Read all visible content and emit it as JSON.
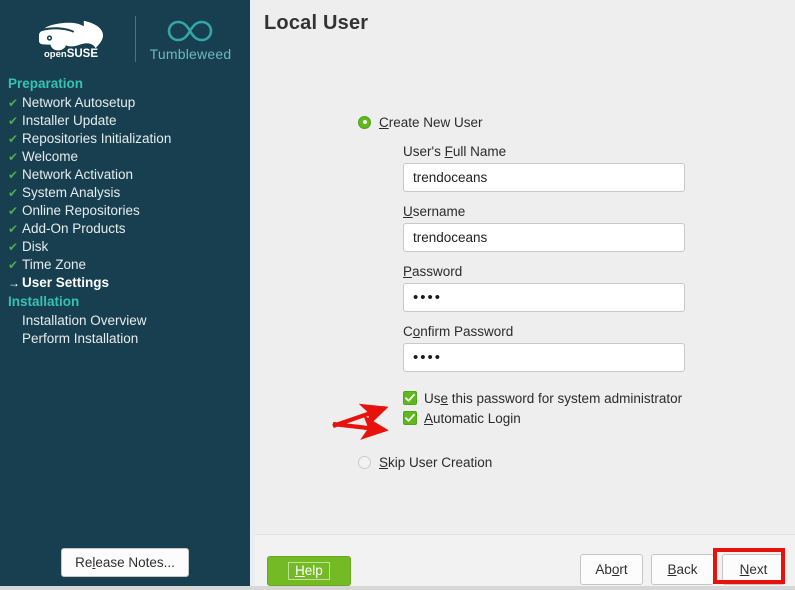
{
  "branding": {
    "product_name": "openSUSE",
    "product_suffix": "SUSE",
    "product_prefix": "open",
    "edition": "Tumbleweed"
  },
  "sidebar": {
    "sections": [
      {
        "name": "Preparation",
        "items": [
          {
            "label": "Network Autosetup",
            "state": "done"
          },
          {
            "label": "Installer Update",
            "state": "done"
          },
          {
            "label": "Repositories Initialization",
            "state": "done"
          },
          {
            "label": "Welcome",
            "state": "done"
          },
          {
            "label": "Network Activation",
            "state": "done"
          },
          {
            "label": "System Analysis",
            "state": "done"
          },
          {
            "label": "Online Repositories",
            "state": "done"
          },
          {
            "label": "Add-On Products",
            "state": "done"
          },
          {
            "label": "Disk",
            "state": "done"
          },
          {
            "label": "Time Zone",
            "state": "done"
          },
          {
            "label": "User Settings",
            "state": "current"
          }
        ]
      },
      {
        "name": "Installation",
        "items": [
          {
            "label": "Installation Overview",
            "state": "pending"
          },
          {
            "label": "Perform Installation",
            "state": "pending"
          }
        ]
      }
    ],
    "release_notes_label": "Release Notes...",
    "release_notes_accel": "l"
  },
  "page": {
    "title": "Local User"
  },
  "form": {
    "create_user": {
      "label": "Create New User",
      "accel": "C",
      "selected": true
    },
    "fields": [
      {
        "label": "User's Full Name",
        "accel": "F",
        "value": "trendoceans",
        "type": "text",
        "name": "full-name"
      },
      {
        "label": "Username",
        "accel": "U",
        "value": "trendoceans",
        "type": "text",
        "name": "username"
      },
      {
        "label": "Password",
        "accel": "P",
        "value": "••••",
        "type": "password",
        "name": "password"
      },
      {
        "label": "Confirm Password",
        "accel": "o",
        "value": "••••",
        "type": "password",
        "name": "confirm-password"
      }
    ],
    "checkboxes": [
      {
        "label": "Use this password for system administrator",
        "accel": "e",
        "checked": true,
        "name": "use-password-for-admin"
      },
      {
        "label": "Automatic Login",
        "accel": "A",
        "checked": true,
        "name": "automatic-login"
      }
    ],
    "skip_user": {
      "label": "Skip User Creation",
      "accel": "S",
      "selected": false
    }
  },
  "footer": {
    "help_label": "Help",
    "help_accel": "H",
    "abort_label": "Abort",
    "abort_accel": "o",
    "back_label": "Back",
    "back_accel": "B",
    "next_label": "Next",
    "next_accel": "N"
  },
  "annotations": {
    "highlight_color": "#e8120c",
    "arrow_color": "#e8120c",
    "arrow_count": 2,
    "highlighted_target": "Next"
  },
  "colors": {
    "sidebar_bg": "#173f4f",
    "content_bg": "#eeeeee",
    "section_heading": "#35c3b0",
    "check_green": "#4caf50",
    "accent_green": "#73ba25",
    "control_green": "#5fb81d",
    "tumbleweed_teal": "#6fb8c0"
  }
}
